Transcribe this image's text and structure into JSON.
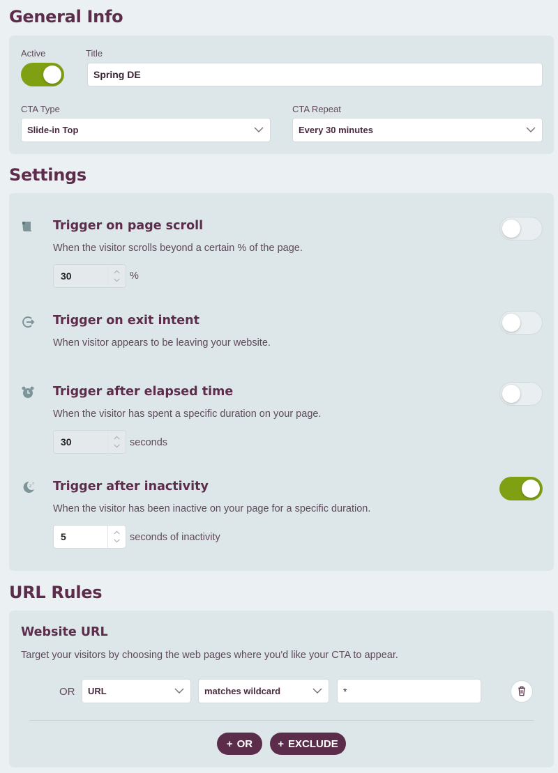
{
  "general": {
    "heading": "General Info",
    "active_label": "Active",
    "active_on": true,
    "title_label": "Title",
    "title_value": "Spring DE",
    "cta_type_label": "CTA Type",
    "cta_type_value": "Slide-in Top",
    "cta_repeat_label": "CTA Repeat",
    "cta_repeat_value": "Every 30 minutes"
  },
  "settings": {
    "heading": "Settings",
    "triggers": [
      {
        "icon": "scroll-icon",
        "title": "Trigger on page scroll",
        "description": "When the visitor scrolls beyond a certain % of the page.",
        "enabled": false,
        "value": "30",
        "unit": "%"
      },
      {
        "icon": "exit-icon",
        "title": "Trigger on exit intent",
        "description": "When visitor appears to be leaving your website.",
        "enabled": false
      },
      {
        "icon": "alarm-clock-icon",
        "title": "Trigger after elapsed time",
        "description": "When the visitor has spent a specific duration on your page.",
        "enabled": false,
        "value": "30",
        "unit": "seconds"
      },
      {
        "icon": "moon-icon",
        "title": "Trigger after inactivity",
        "description": "When the visitor has been inactive on your page for a specific duration.",
        "enabled": true,
        "value": "5",
        "unit": "seconds of inactivity"
      }
    ]
  },
  "url_rules": {
    "heading": "URL Rules",
    "section_title": "Website URL",
    "description": "Target your visitors by choosing the web pages where you'd like your CTA to appear.",
    "rule": {
      "connector": "OR",
      "field": "URL",
      "operator": "matches wildcard",
      "value": "*"
    },
    "or_button": "OR",
    "exclude_button": "EXCLUDE"
  },
  "colors": {
    "brand": "#5c2d4b",
    "toggle_on": "#7fa012",
    "panel": "#dde6e8",
    "background": "#ebf0f2"
  }
}
